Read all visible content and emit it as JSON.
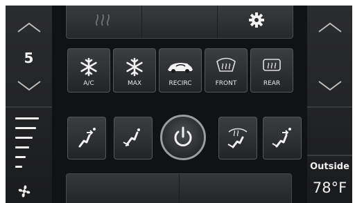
{
  "temperature": {
    "setpoint": "5"
  },
  "fan": {
    "level": 0.5,
    "bars": 6
  },
  "outside": {
    "label": "Outside",
    "temperature": "78°F"
  },
  "buttons": {
    "ac": "A/C",
    "max": "MAX",
    "recirc": "RECIRC",
    "front": "FRONT",
    "rear": "REAR"
  },
  "icons": {
    "top": [
      "heated-seat-icon",
      "gear-icon"
    ],
    "row1": [
      "snowflake-icon",
      "snowflake-icon",
      "car-recirculation-icon",
      "front-defrost-icon",
      "rear-defrost-icon"
    ],
    "row2": [
      "airflow-face-icon",
      "airflow-feet-icon",
      "power-icon",
      "airflow-defrost-feet-icon",
      "airflow-face-feet-icon"
    ],
    "fan": "fan-icon"
  },
  "colors": {
    "background": "#111214",
    "button": "#2e3033",
    "text": "#f2f2f2"
  }
}
